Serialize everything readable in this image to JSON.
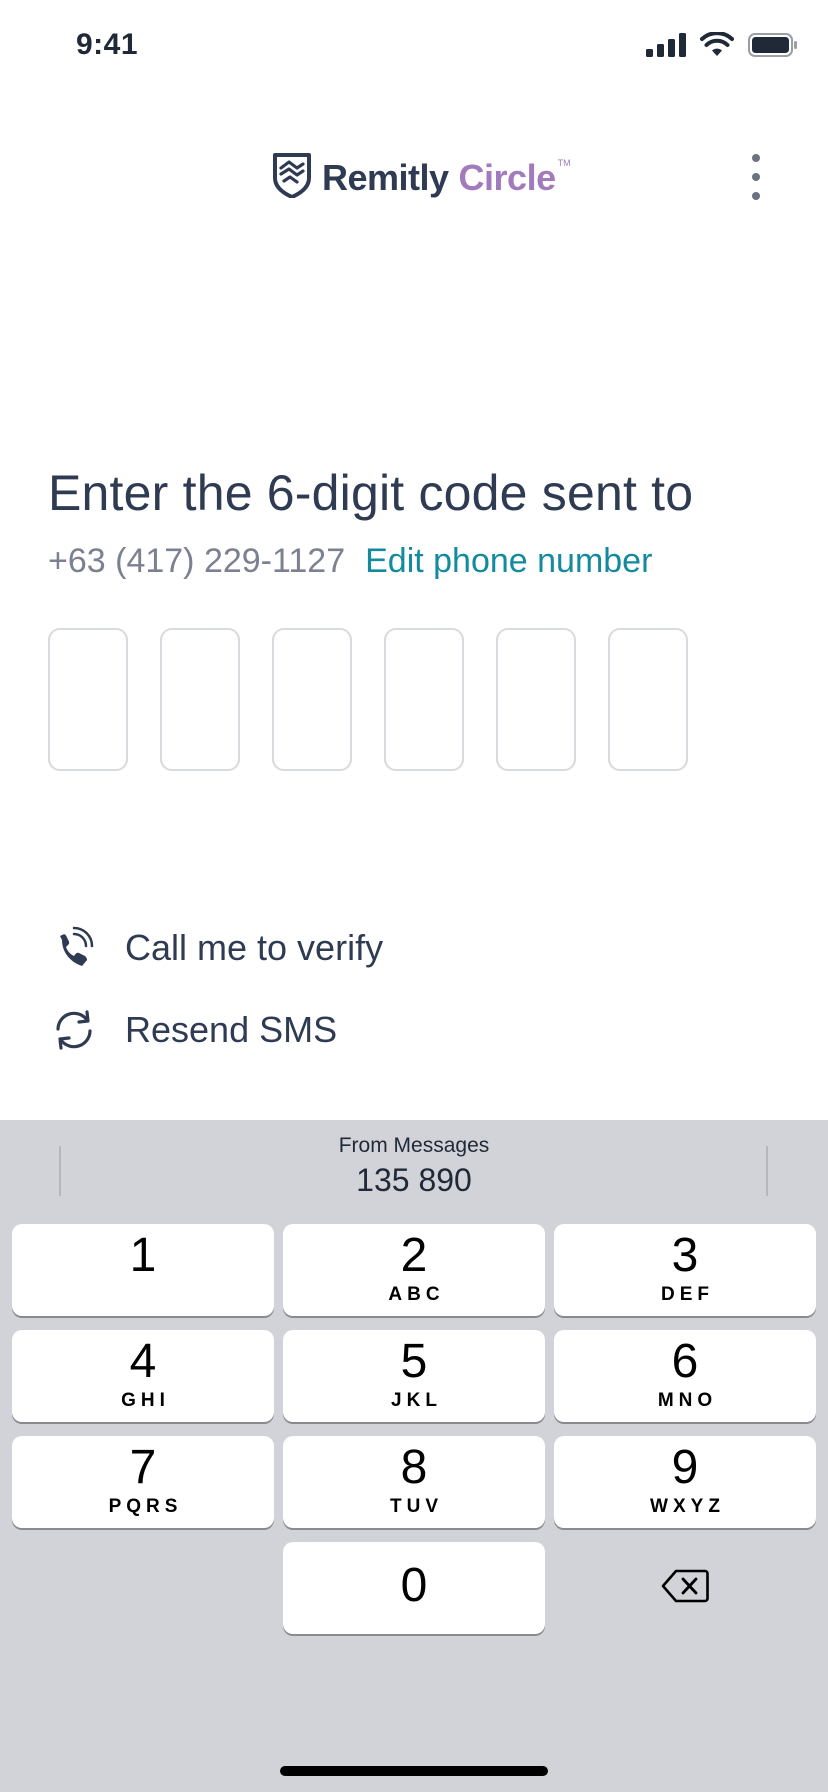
{
  "status_bar": {
    "time": "9:41",
    "signal_icon": "cellular-signal-icon",
    "wifi_icon": "wifi-icon",
    "battery_icon": "battery-icon"
  },
  "header": {
    "logo_icon": "handshake-shield-icon",
    "logo_word_1": "Remitly",
    "logo_word_2": "Circle",
    "logo_tm": "TM",
    "more_icon": "more-vertical-icon"
  },
  "verification": {
    "title": "Enter the 6-digit code sent to",
    "phone_number": "+63 (417) 229-1127",
    "edit_link": "Edit phone number",
    "code_digits": [
      "",
      "",
      "",
      "",
      "",
      ""
    ]
  },
  "actions": {
    "call_icon": "phone-icon",
    "call_label": "Call me to verify",
    "resend_icon": "refresh-icon",
    "resend_label": "Resend SMS"
  },
  "keyboard": {
    "suggestion_source": "From Messages",
    "suggestion_code": "135 890",
    "keys": [
      {
        "digit": "1",
        "letters": ""
      },
      {
        "digit": "2",
        "letters": "ABC"
      },
      {
        "digit": "3",
        "letters": "DEF"
      },
      {
        "digit": "4",
        "letters": "GHI"
      },
      {
        "digit": "5",
        "letters": "JKL"
      },
      {
        "digit": "6",
        "letters": "MNO"
      },
      {
        "digit": "7",
        "letters": "PQRS"
      },
      {
        "digit": "8",
        "letters": "TUV"
      },
      {
        "digit": "9",
        "letters": "WXYZ"
      },
      {
        "digit": "0",
        "letters": ""
      }
    ],
    "delete_icon": "backspace-icon"
  },
  "colors": {
    "brand_navy": "#2f3b52",
    "brand_purple": "#a27bbd",
    "link_teal": "#138a9e",
    "keyboard_bg": "#d1d3d9"
  }
}
